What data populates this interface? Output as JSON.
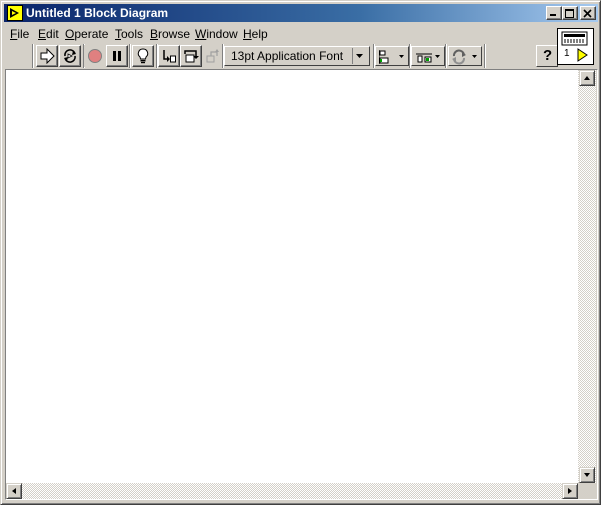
{
  "window": {
    "title": "Untitled 1 Block Diagram"
  },
  "menu": [
    {
      "label": "File",
      "underline": "F",
      "rest": "ile"
    },
    {
      "label": "Edit",
      "underline": "E",
      "rest": "dit"
    },
    {
      "label": "Operate",
      "underline": "O",
      "rest": "perate"
    },
    {
      "label": "Tools",
      "underline": "T",
      "rest": "ools"
    },
    {
      "label": "Browse",
      "underline": "B",
      "rest": "rowse"
    },
    {
      "label": "Window",
      "underline": "W",
      "rest": "indow"
    },
    {
      "label": "Help",
      "underline": "H",
      "rest": "elp"
    }
  ],
  "toolbar": {
    "font_ring": "13pt Application Font",
    "help": "?"
  },
  "connector_pane": {
    "number": "1"
  },
  "icons": {
    "app": "labview-app-icon",
    "run": "run-arrow-icon",
    "run_continuous": "run-continuously-icon",
    "abort": "abort-icon",
    "pause": "pause-icon",
    "highlight": "highlight-execution-icon",
    "retain": "retain-wire-values-icon",
    "step_into": "step-into-icon",
    "step_over": "step-over-icon",
    "step_out": "step-out-icon",
    "align": "align-objects-icon",
    "distribute": "distribute-objects-icon",
    "reorder": "reorder-icon"
  }
}
